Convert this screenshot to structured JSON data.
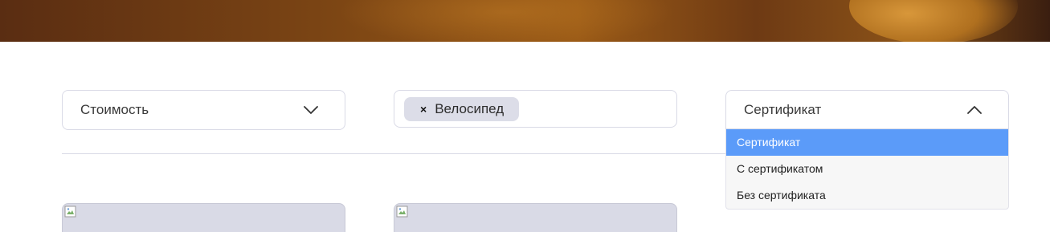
{
  "filters": {
    "price": {
      "label": "Стоимость",
      "icon": "chevron-down-icon"
    },
    "category": {
      "tags": [
        {
          "label": "Велосипед",
          "remove": "×"
        }
      ]
    },
    "certificate": {
      "label": "Сертификат",
      "icon": "chevron-up-icon",
      "options": [
        {
          "label": "Сертификат",
          "selected": true
        },
        {
          "label": "С сертификатом",
          "selected": false
        },
        {
          "label": "Без сертификата",
          "selected": false
        }
      ]
    }
  },
  "colors": {
    "selected_option": "#5b9bf9",
    "border": "#d9dae6",
    "tag_bg": "#dcdde8",
    "card_placeholder": "#d9dae6"
  }
}
